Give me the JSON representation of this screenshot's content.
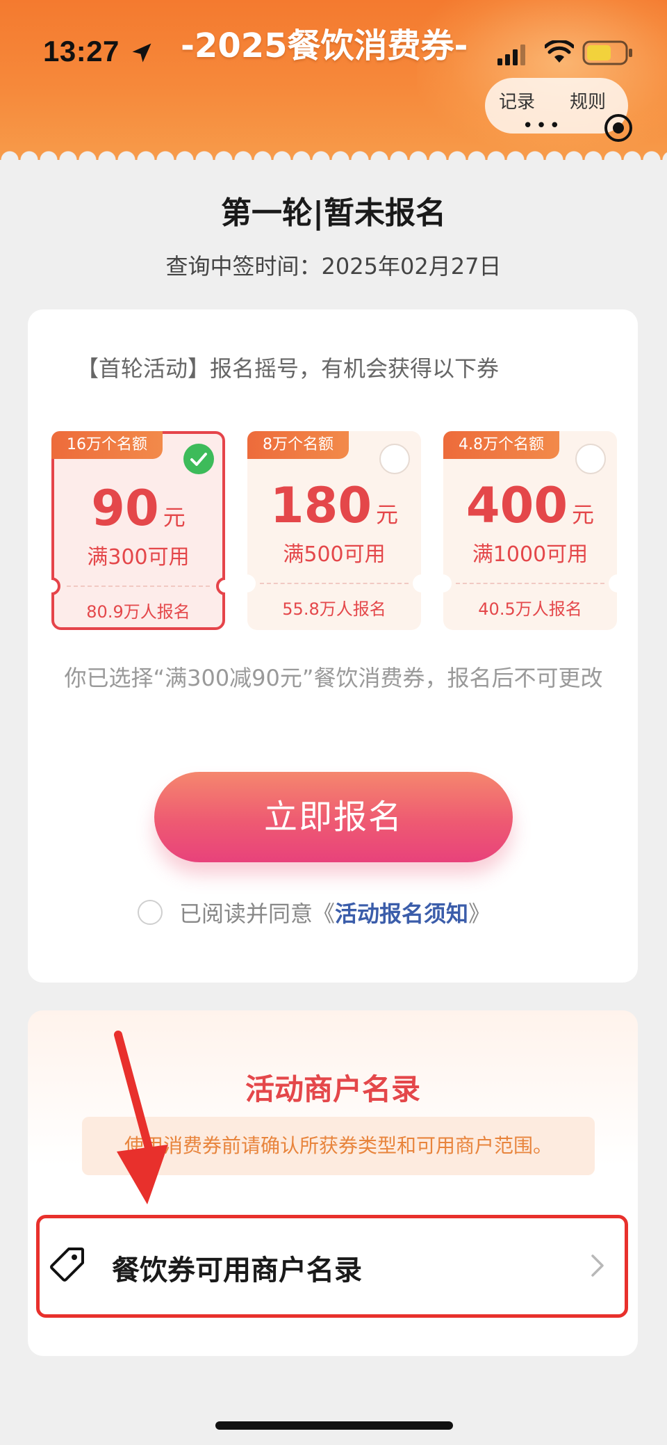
{
  "status_bar": {
    "time": "13:27"
  },
  "header": {
    "title": "-2025餐饮消费券-",
    "capsule": {
      "record": "记录",
      "rules": "规则",
      "more": "•••"
    }
  },
  "round": {
    "title": "第一轮|暂未报名",
    "query_time": "查询中签时间：2025年02月27日"
  },
  "activity": {
    "intro": "【首轮活动】报名摇号，有机会获得以下券",
    "coupons": [
      {
        "quota": "16万个名额",
        "amount": "90",
        "unit": "元",
        "condition": "满300可用",
        "signups": "80.9万人报名",
        "selected": true
      },
      {
        "quota": "8万个名额",
        "amount": "180",
        "unit": "元",
        "condition": "满500可用",
        "signups": "55.8万人报名",
        "selected": false
      },
      {
        "quota": "4.8万个名额",
        "amount": "400",
        "unit": "元",
        "condition": "满1000可用",
        "signups": "40.5万人报名",
        "selected": false
      }
    ],
    "notice": "你已选择“满300减90元”餐饮消费券，报名后不可更改",
    "signup_button": "立即报名",
    "agree_prefix": "已阅读并同意《",
    "agree_link": "活动报名须知",
    "agree_suffix": "》"
  },
  "merchants": {
    "title": "活动商户名录",
    "note": "使用消费券前请确认所获券类型和可用商户范围。",
    "row_label": "餐饮券可用商户名录"
  },
  "colors": {
    "accent_red": "#e4474a",
    "header_orange": "#f47a2f",
    "button_pink": "#ee5a72",
    "link_blue": "#3b5daa",
    "annotation_red": "#e8302c"
  },
  "icons": [
    "location-arrow-icon",
    "signal-icon",
    "wifi-icon",
    "battery-icon",
    "more-dots-icon",
    "close-target-icon",
    "check-icon",
    "tag-icon",
    "chevron-right-icon"
  ]
}
